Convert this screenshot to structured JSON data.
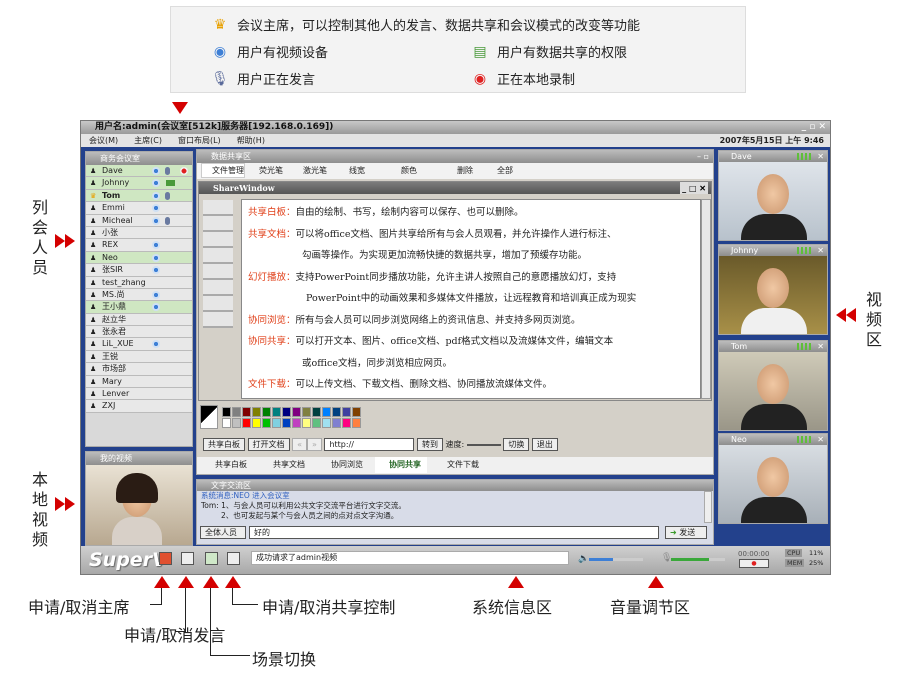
{
  "legend": [
    {
      "icon": "crown-icon",
      "text": "会议主席，可以控制其他人的发言、数据共享和会议模式的改变等功能"
    },
    {
      "icon": "webcam-icon",
      "text": "用户有视频设备"
    },
    {
      "icon": "data-share-icon",
      "text": "用户有数据共享的权限"
    },
    {
      "icon": "microphone-icon",
      "text": "用户正在发言"
    },
    {
      "icon": "record-icon",
      "text": "正在本地录制"
    }
  ],
  "window": {
    "title": "用户名:admin(会议室[512k]服务器[192.168.0.169])",
    "menu": [
      "会议(M)",
      "主席(C)",
      "窗口布局(L)",
      "帮助(H)"
    ],
    "datetime": "2007年5月15日 上午 9:46"
  },
  "participants": {
    "title": "商务会议室",
    "items": [
      {
        "name": "Dave",
        "cam": true,
        "mic": true,
        "rec": true,
        "hl": true
      },
      {
        "name": "Johnny",
        "cam": true,
        "share": true,
        "hl": true
      },
      {
        "name": "Tom",
        "cam": true,
        "mic": true,
        "chair": true,
        "hl": true
      },
      {
        "name": "Emmi",
        "cam": true
      },
      {
        "name": "Micheal",
        "cam": true,
        "mic": true
      },
      {
        "name": "小张"
      },
      {
        "name": "REX",
        "cam": true
      },
      {
        "name": "Neo",
        "cam": true,
        "hl": true
      },
      {
        "name": "张SIR",
        "cam": true
      },
      {
        "name": "test_zhang"
      },
      {
        "name": "MS.尚",
        "cam": true
      },
      {
        "name": "王小鼎",
        "cam": true,
        "hl": true
      },
      {
        "name": "赵立华"
      },
      {
        "name": "张永君"
      },
      {
        "name": "LiL_XUE",
        "cam": true
      },
      {
        "name": "王锐"
      },
      {
        "name": "市场部"
      },
      {
        "name": "Mary"
      },
      {
        "name": "Lenver"
      },
      {
        "name": "ZXJ"
      }
    ]
  },
  "local_video": {
    "title": "我的视频"
  },
  "datashare": {
    "title": "数据共享区",
    "toolbar": [
      "文件管理",
      "荧光笔",
      "激光笔",
      "线宽",
      "颜色",
      "删除",
      "全部"
    ],
    "sharewindow_title": "ShareWindow",
    "content": [
      {
        "label": "共享白板：",
        "lines": [
          "自由的绘制、书写，绘制内容可以保存、也可以删除。"
        ]
      },
      {
        "label": "共享文档：",
        "lines": [
          "可以将office文档、图片共享给所有与会人员观看，并允许操作人进行标注、",
          "勾画等操作。为实现更加流畅快捷的数据共享，增加了预缓存功能。"
        ]
      },
      {
        "label": "幻灯播放：",
        "lines": [
          "支持PowerPoint同步播放功能，允许主讲人按照自己的意愿播放幻灯，支持",
          "PowerPoint中的动画效果和多媒体文件播放，让远程教育和培训真正成为现实"
        ]
      },
      {
        "label": "协同浏览：",
        "lines": [
          "所有与会人员可以同步浏览网络上的资讯信息、并支持多网页浏览。"
        ]
      },
      {
        "label": "协同共享：",
        "lines": [
          "可以打开文本、图片、office文档、pdf格式文档以及流媒体文件，编辑文本",
          "或office文档，同步浏览相应网页。"
        ]
      },
      {
        "label": "文件下载：",
        "lines": [
          "可以上传文档、下载文档、删除文档、协同播放流媒体文件。"
        ]
      }
    ],
    "palette": [
      "#000000",
      "#808080",
      "#800000",
      "#808000",
      "#008000",
      "#008080",
      "#000080",
      "#800080",
      "#808040",
      "#004040",
      "#0080ff",
      "#004080",
      "#4040a0",
      "#804000",
      "#ffffff",
      "#c0c0c0",
      "#ff0000",
      "#ffff00",
      "#00c000",
      "#80d0e0",
      "#0040c0",
      "#c040c0",
      "#ffff80",
      "#60c080",
      "#a0e0f0",
      "#8080d0",
      "#ff0080",
      "#ff8040"
    ],
    "controls": {
      "whiteboard": "共享白板",
      "open_doc": "打开文档",
      "url": "http://",
      "go": "转到",
      "speed": "速度:",
      "switch": "切换",
      "exit": "退出"
    },
    "tabs": [
      "共享白板",
      "共享文档",
      "协同浏览",
      "协同共享",
      "文件下载"
    ],
    "active_tab": 3
  },
  "chat": {
    "title": "文字交流区",
    "system": "系统消息:NEO 进入会议室",
    "speaker": "Tom:",
    "lines": [
      "1、与会人员可以利用公共文字交流平台进行文字交流。",
      "2、也可发起与某个与会人员之间的点对点文字沟通。"
    ],
    "recipient": "全体人员",
    "input": "好的",
    "send": "发送"
  },
  "videos": [
    "Dave",
    "Johnny",
    "Tom",
    "Neo"
  ],
  "statusbar": {
    "logo": "SuperV",
    "message": "成功请求了admin视频",
    "timer": "00:00:00",
    "cpu_label": "CPU",
    "cpu": "11%",
    "mem_label": "MEM",
    "mem": "25%",
    "speaker_volume": 0.45,
    "mic_volume": 0.7
  },
  "annotations": {
    "participants": "列会人员",
    "local_video": "本地视频",
    "video_area": "视频区",
    "chair": "申请/取消主席",
    "speak": "申请/取消发言",
    "scene": "场景切换",
    "share_control": "申请/取消共享控制",
    "sysinfo": "系统信息区",
    "volume": "音量调节区"
  },
  "colors": {
    "accent_red": "#d40000",
    "frame_blue": "#23418c",
    "label_orange": "#e0401a"
  }
}
